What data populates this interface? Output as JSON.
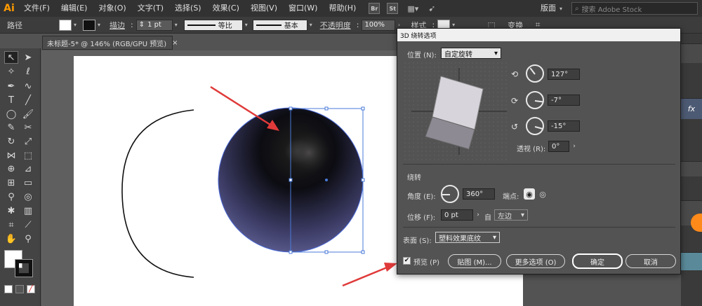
{
  "app": {
    "logo": "Ai"
  },
  "menu": [
    "文件(F)",
    "编辑(E)",
    "对象(O)",
    "文字(T)",
    "选择(S)",
    "效果(C)",
    "视图(V)",
    "窗口(W)",
    "帮助(H)"
  ],
  "badges": {
    "bridge": "Br",
    "stock": "St"
  },
  "workspace_label": "版面",
  "search": {
    "placeholder": "搜索 Adobe Stock"
  },
  "control": {
    "object_label": "路径",
    "stroke_label": "描边",
    "stroke_value": "1 pt",
    "profile_label": "等比",
    "brush_label": "基本",
    "opacity_label": "不透明度",
    "opacity_value": "100%",
    "style_label": "样式",
    "transform_label": "变换"
  },
  "doc_tab": {
    "title": "未标题-5* @ 146% (RGB/GPU 预览)",
    "close": "×"
  },
  "dialog": {
    "title": "3D 绕转选项",
    "position_label": "位置 (N):",
    "position_value": "自定旋转",
    "rot_x": "127°",
    "rot_y": "-7°",
    "rot_z": "-15°",
    "perspective_label": "透视 (R):",
    "perspective_value": "0°",
    "revolve_section": "绕转",
    "angle_label": "角度 (E):",
    "angle_value": "360°",
    "cap_label": "端点:",
    "offset_label": "位移 (F):",
    "offset_value": "0 pt",
    "from_label": "自",
    "from_value": "左边",
    "surface_label": "表面 (S):",
    "surface_value": "塑料效果底纹",
    "preview_label": "预览 (P)",
    "map_button": "贴图 (M)...",
    "more_button": "更多选项 (O)",
    "ok_button": "确定",
    "cancel_button": "取消"
  },
  "panel_icons": {
    "fx": "fx"
  },
  "colors": {
    "accent_red": "#e03a3a",
    "sphere_dark": "#111111",
    "sphere_edge": "#5a5a8c",
    "selection_blue": "#4a7ad8"
  }
}
